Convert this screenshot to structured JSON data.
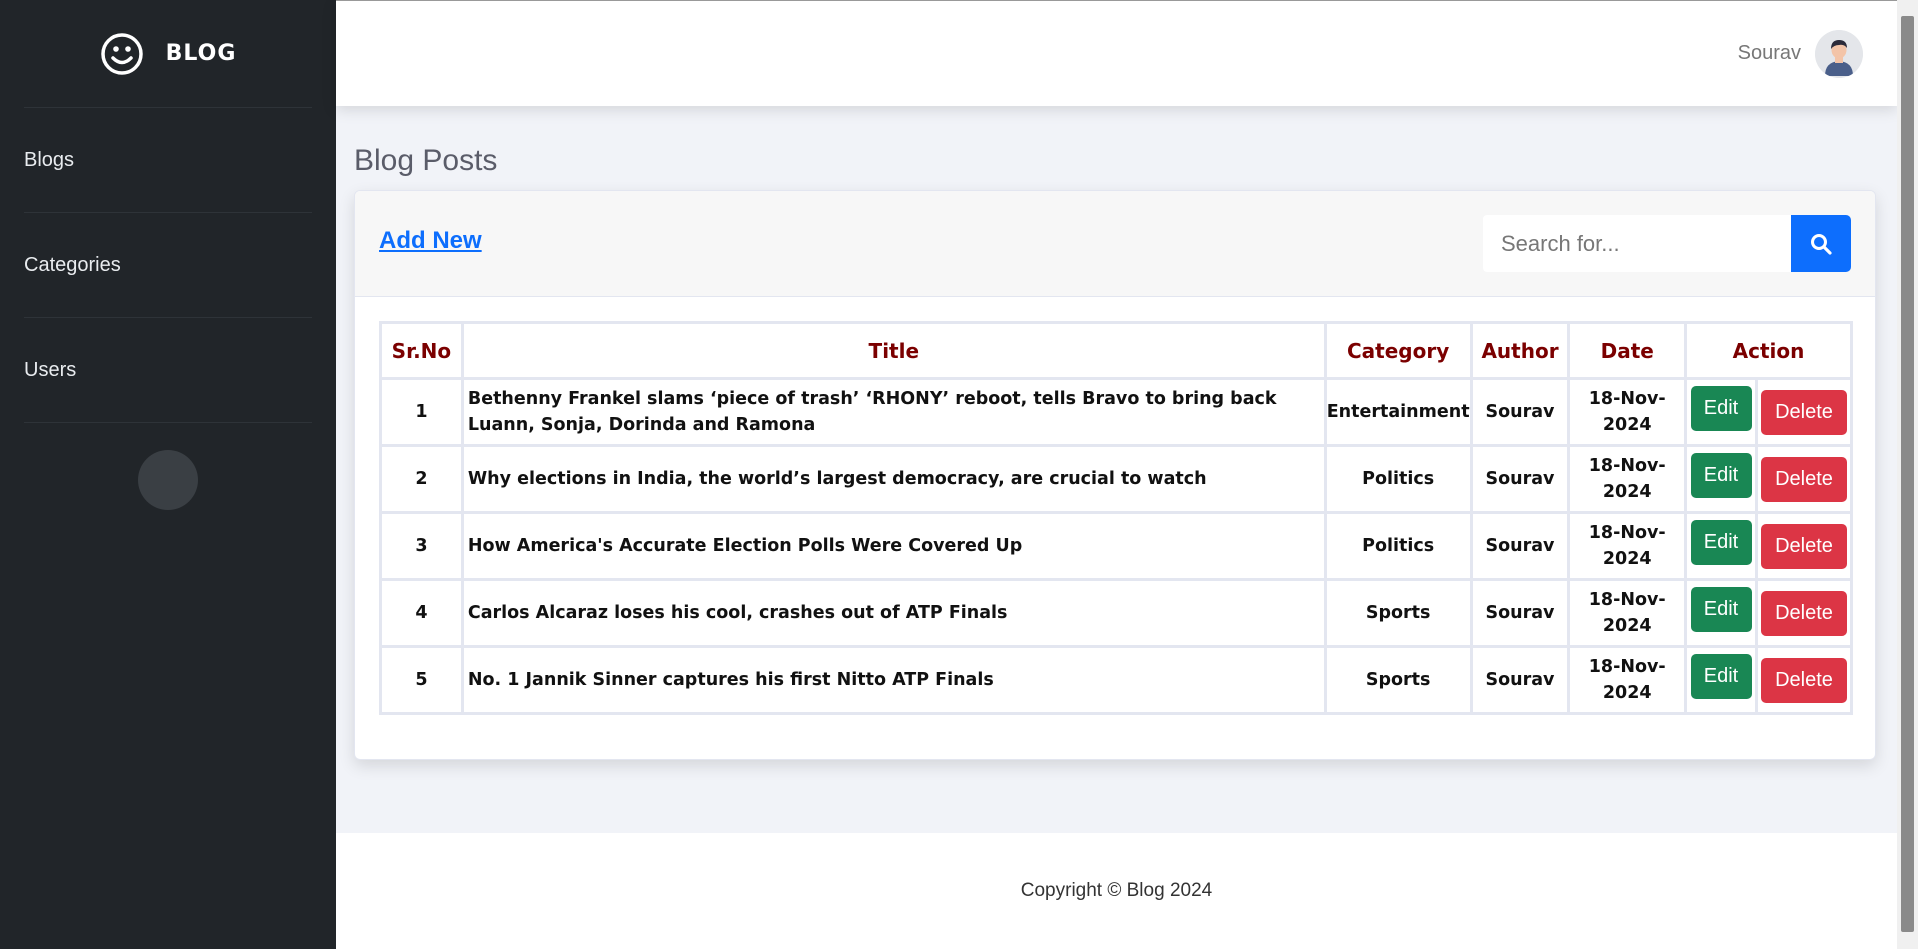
{
  "brand": {
    "name": "BLOG"
  },
  "sidebar": {
    "items": [
      {
        "label": "Blogs"
      },
      {
        "label": "Categories"
      },
      {
        "label": "Users"
      }
    ],
    "toggle_glyph": ""
  },
  "topbar": {
    "user_name": "Sourav"
  },
  "main": {
    "page_title": "Blog Posts",
    "add_new_label": "Add New",
    "search": {
      "placeholder": "Search for..."
    }
  },
  "table": {
    "headers": [
      "Sr.No",
      "Title",
      "Category",
      "Author",
      "Date",
      "Action"
    ],
    "edit_label": "Edit",
    "delete_label": "Delete",
    "rows": [
      {
        "sr": "1",
        "title": "Bethenny Frankel slams ‘piece of trash’ ‘RHONY’ reboot, tells Bravo to bring back Luann, Sonja, Dorinda and Ramona",
        "category": "Entertainment",
        "author": "Sourav",
        "date": "18-Nov-2024"
      },
      {
        "sr": "2",
        "title": "Why elections in India, the world’s largest democracy, are crucial to watch",
        "category": "Politics",
        "author": "Sourav",
        "date": "18-Nov-2024"
      },
      {
        "sr": "3",
        "title": "How America's Accurate Election Polls Were Covered Up",
        "category": "Politics",
        "author": "Sourav",
        "date": "18-Nov-2024"
      },
      {
        "sr": "4",
        "title": "Carlos Alcaraz loses his cool, crashes out of ATP Finals",
        "category": "Sports",
        "author": "Sourav",
        "date": "18-Nov-2024"
      },
      {
        "sr": "5",
        "title": "No. 1 Jannik Sinner captures his first Nitto ATP Finals",
        "category": "Sports",
        "author": "Sourav",
        "date": "18-Nov-2024"
      }
    ]
  },
  "footer": {
    "text": "Copyright © Blog 2024"
  },
  "colors": {
    "sidebar_bg": "#212529",
    "primary": "#0d6efd",
    "edit": "#198754",
    "delete": "#dc3545",
    "header_text": "#7b0000"
  }
}
